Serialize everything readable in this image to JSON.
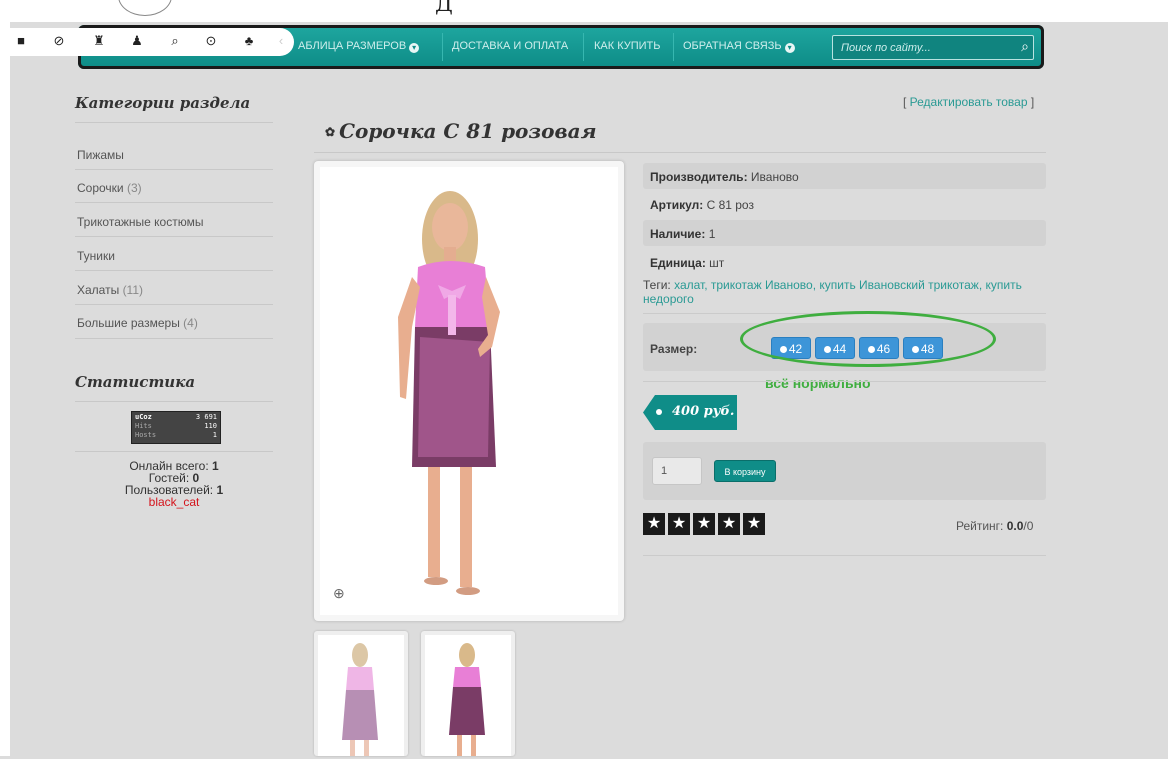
{
  "nav": {
    "items": [
      "АБЛИЦА РАЗМЕРОВ",
      "ДОСТАВКА И ОПЛАТА",
      "КАК КУПИТЬ",
      "ОБРАТНАЯ СВЯЗЬ"
    ],
    "search_placeholder": "Поиск по сайту..."
  },
  "sidebar": {
    "title": "Категории раздела",
    "categories": [
      {
        "name": "Пижамы",
        "count": ""
      },
      {
        "name": "Сорочки",
        "count": "(3)"
      },
      {
        "name": "Трикотажные костюмы",
        "count": ""
      },
      {
        "name": "Туники",
        "count": ""
      },
      {
        "name": "Халаты",
        "count": "(11)"
      },
      {
        "name": "Большие размеры",
        "count": "(4)"
      }
    ],
    "stats_title": "Статистика",
    "counter": {
      "logo": "uCoz",
      "hits_label": "Hits",
      "hosts_label": "Hosts",
      "top": "3 691",
      "hits": "110",
      "hosts": "1"
    },
    "online": {
      "total_label": "Онлайн всего:",
      "total": "1",
      "guests_label": "Гостей:",
      "guests": "0",
      "users_label": "Пользователей:",
      "users": "1",
      "username": "black_cat"
    }
  },
  "product": {
    "edit_link": "Редактировать товар",
    "title": "Сорочка С 81 розовая",
    "manufacturer_label": "Производитель:",
    "manufacturer": "Иваново",
    "sku_label": "Артикул:",
    "sku": "С 81 роз",
    "stock_label": "Наличие:",
    "stock": "1",
    "unit_label": "Единица:",
    "unit": "шт",
    "tags_label": "Теги:",
    "tags": "халат, трикотаж Иваново, купить Ивановский трикотаж, купить недорого",
    "size_label": "Размер:",
    "sizes": [
      "42",
      "44",
      "46",
      "48"
    ],
    "annotation": "всё нормально",
    "price": "400 руб.",
    "qty": "1",
    "cart_button": "В корзину",
    "rating_label": "Рейтинг:",
    "rating_value": "0.0",
    "rating_count": "/0"
  },
  "colors": {
    "accent": "#0f8d88",
    "size_button": "#3d95d8",
    "annotation": "#3fae3f",
    "username": "#d4141c"
  },
  "icons": [
    "folder-icon",
    "block-icon",
    "basket-icon",
    "bell-icon",
    "search-icon",
    "eye-icon",
    "puzzle-icon",
    "gear-icon",
    "zoom-icon",
    "star-icon"
  ]
}
